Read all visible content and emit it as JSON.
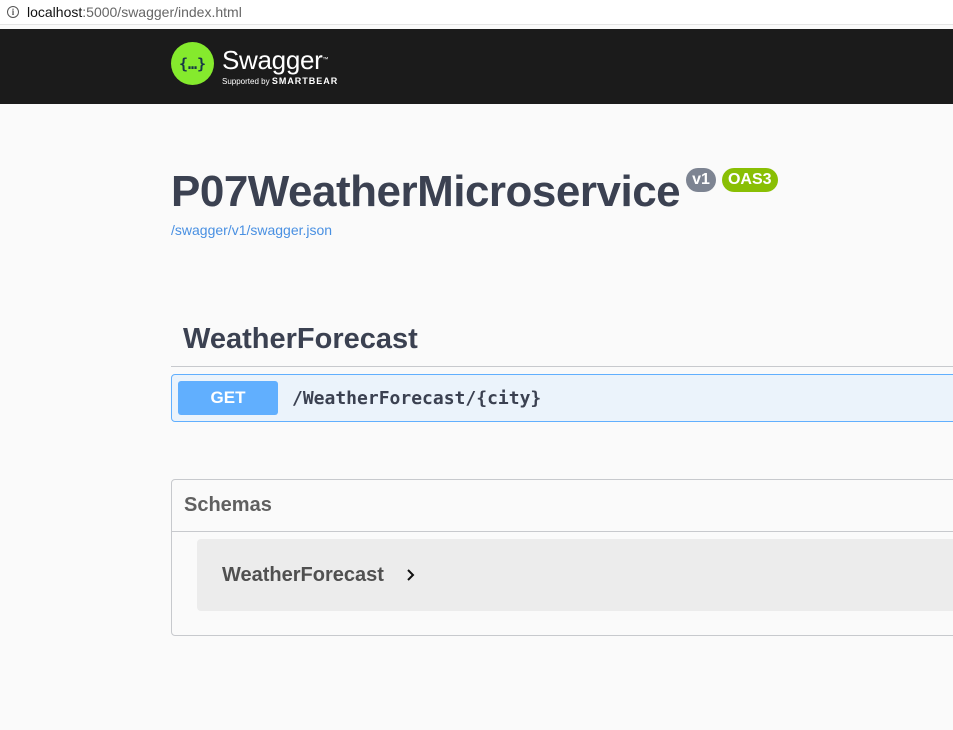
{
  "browser": {
    "url_host": "localhost",
    "url_rest": ":5000/swagger/index.html"
  },
  "topbar": {
    "brand": "Swagger",
    "tm": "™",
    "supported_by_prefix": "Supported by ",
    "supported_by_brand": "SMARTBEAR",
    "logo_glyph": "{…}"
  },
  "info": {
    "title": "P07WeatherMicroservice",
    "version_badge": "v1",
    "oas_badge": "OAS3",
    "spec_url": "/swagger/v1/swagger.json"
  },
  "tags": [
    {
      "name": "WeatherForecast",
      "operations": [
        {
          "method": "GET",
          "path": "/WeatherForecast/{city}"
        }
      ]
    }
  ],
  "schemas": {
    "title": "Schemas",
    "models": [
      {
        "name": "WeatherForecast"
      }
    ]
  },
  "colors": {
    "topbar_bg": "#1b1b1b",
    "logo_green": "#85ea2d",
    "get_blue": "#61affe",
    "oas_green": "#89bf04",
    "version_gray": "#7d8492",
    "link_blue": "#4990e2"
  }
}
